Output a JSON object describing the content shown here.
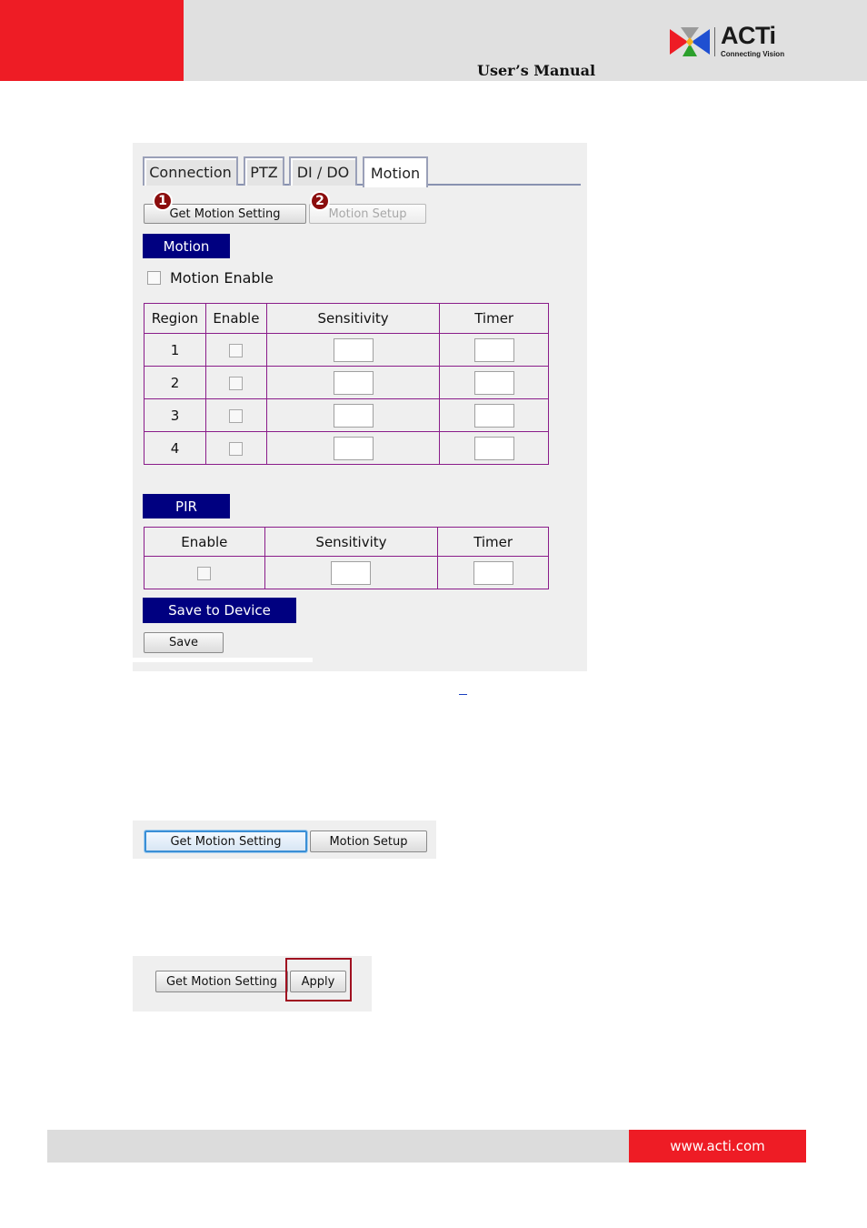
{
  "header": {
    "title": "User’s Manual",
    "logo_text": "ACTi",
    "logo_tagline": "Connecting Vision",
    "brand_red": "#ee1c25"
  },
  "figure1": {
    "tabs": [
      "Connection",
      "PTZ",
      "DI / DO",
      "Motion"
    ],
    "active_tab": "Motion",
    "markers": [
      "1",
      "2"
    ],
    "get_motion_setting_label": "Get Motion Setting",
    "motion_setup_label": "Motion Setup",
    "motion_section_title": "Motion",
    "motion_enable_label": "Motion Enable",
    "motion_table": {
      "headers": [
        "Region",
        "Enable",
        "Sensitivity",
        "Timer"
      ],
      "regions": [
        "1",
        "2",
        "3",
        "4"
      ]
    },
    "pir_section_title": "PIR",
    "pir_table": {
      "headers": [
        "Enable",
        "Sensitivity",
        "Timer"
      ]
    },
    "save_section_title": "Save to Device",
    "save_button_label": "Save",
    "section_color": "#000080"
  },
  "figure2": {
    "get_motion_setting_label": "Get Motion Setting",
    "motion_setup_label": "Motion Setup"
  },
  "figure3": {
    "get_motion_setting_label": "Get Motion Setting",
    "apply_label": "Apply"
  },
  "footer": {
    "url": "www.acti.com"
  }
}
